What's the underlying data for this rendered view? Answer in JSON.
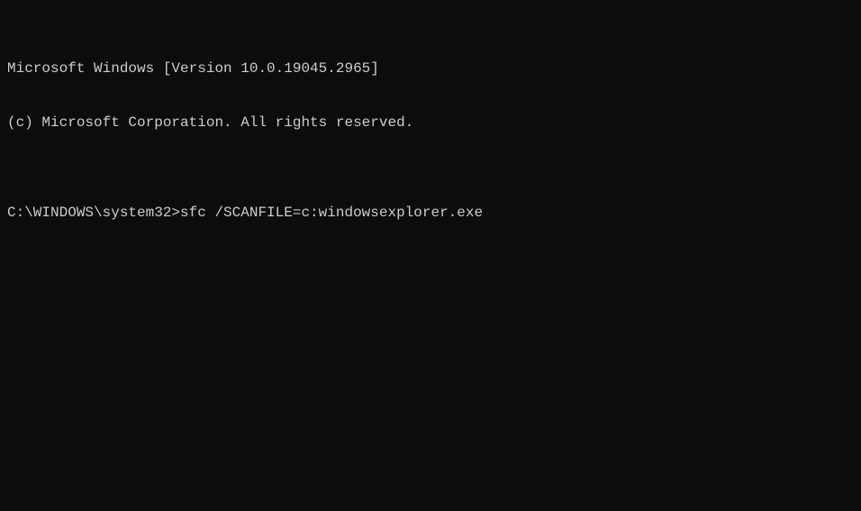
{
  "terminal": {
    "header_line1": "Microsoft Windows [Version 10.0.19045.2965]",
    "header_line2": "(c) Microsoft Corporation. All rights reserved.",
    "blank_line": "",
    "prompt": "C:\\WINDOWS\\system32>",
    "command": "sfc /SCANFILE=c:windowsexplorer.exe"
  }
}
